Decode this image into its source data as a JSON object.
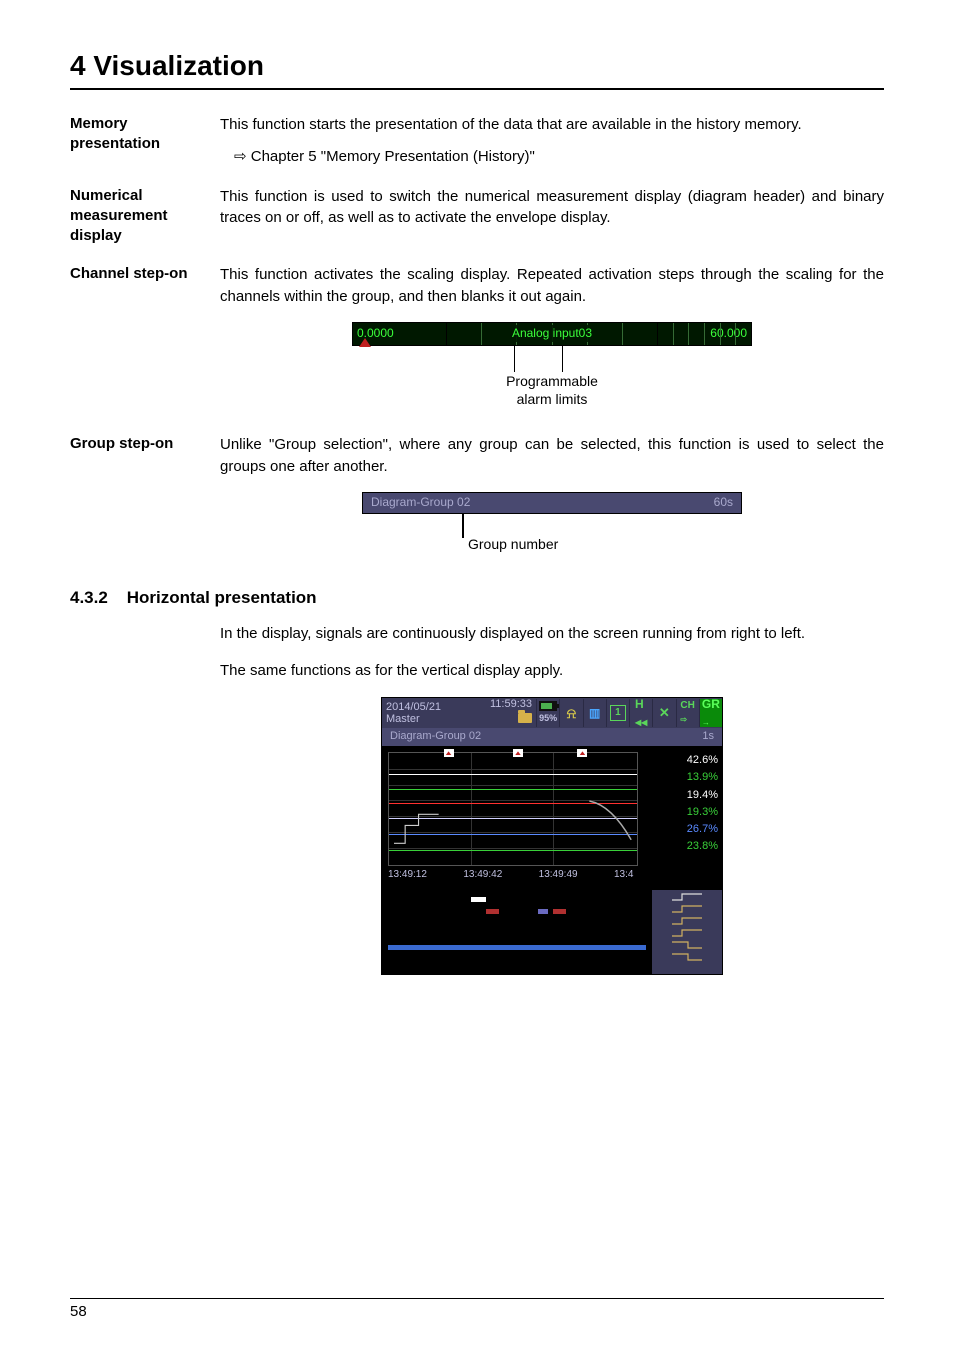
{
  "chapter_title": "4 Visualization",
  "sections": {
    "memory": {
      "head": "Memory presentation",
      "text": "This function starts the presentation of the data that are available in the history memory.",
      "link": "Chapter 5 \"Memory Presentation (History)\""
    },
    "numerical": {
      "head": "Numerical measurement display",
      "text": "This function is used to switch the numerical measurement display (diagram header) and binary traces on or off, as well as to activate the envelope display."
    },
    "channel": {
      "head": "Channel step-on",
      "text": "This function activates the scaling display. Repeated activation steps through the scaling for the channels within the group, and then blanks it out again.",
      "scale_left": "0.0000",
      "scale_mid": "Analog input03",
      "scale_right": "60.000",
      "caption1": "Programmable",
      "caption2": "alarm limits"
    },
    "group": {
      "head": "Group step-on",
      "text": "Unlike \"Group selection\", where any group can be selected, this function is used to select the groups one after another.",
      "bar_left": "Diagram-Group 02",
      "bar_right": "60s",
      "caption": "Group number"
    }
  },
  "subsection": {
    "num": "4.3.2",
    "title": "Horizontal presentation",
    "p1": "In the display, signals are continuously displayed on the screen running from right to left.",
    "p2": "The same functions as for the vertical display apply."
  },
  "shot": {
    "date": "2014/05/21",
    "mode": "Master",
    "time": "11:59:33",
    "battery_pct": "95%",
    "toolbar_one": "1",
    "toolbar_h": "H",
    "toolbar_ch": "CH",
    "toolbar_gr": "GR",
    "sub_left": "Diagram-Group 02",
    "sub_right": "1s",
    "legend": [
      "42.6%",
      "13.9%",
      "19.4%",
      "19.3%",
      "26.7%",
      "23.8%"
    ],
    "legend_colors": [
      "#ffffff",
      "#39d039",
      "#ffffff",
      "#39d039",
      "#5a8aff",
      "#39d039"
    ],
    "xticks": [
      "13:49:12",
      "13:49:42",
      "13:49:49",
      "13:4"
    ]
  },
  "page_number": "58"
}
